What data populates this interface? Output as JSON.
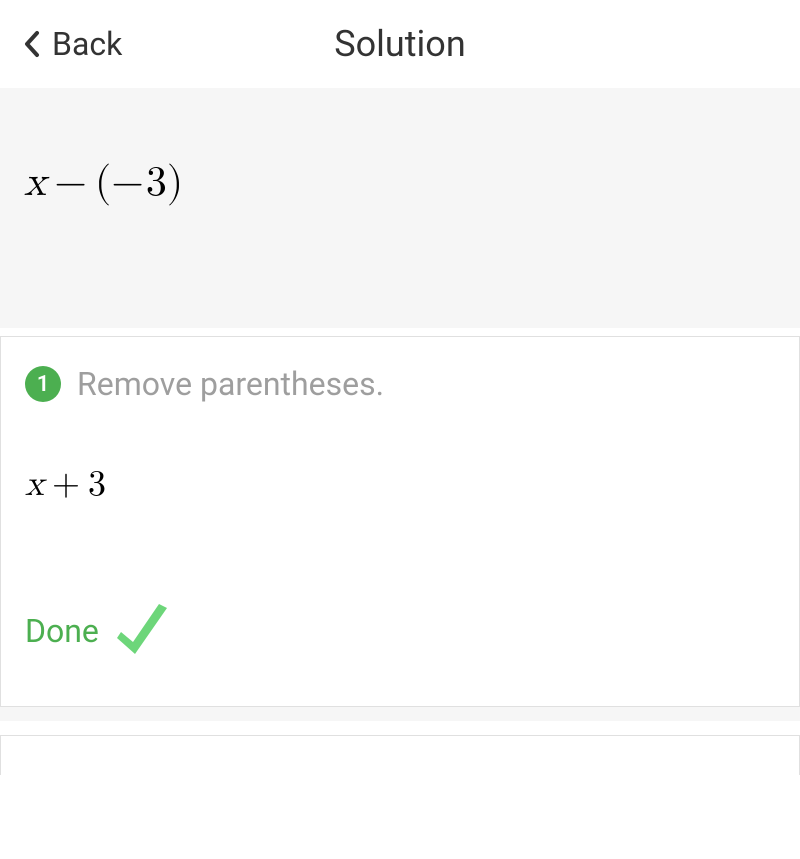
{
  "header": {
    "back_label": "Back",
    "title": "Solution"
  },
  "problem": {
    "expression_var": "x",
    "expression_op1": "−",
    "expression_paren_open": "(",
    "expression_op2": "−",
    "expression_val": "3",
    "expression_paren_close": ")"
  },
  "step": {
    "number": "1",
    "description": "Remove parentheses.",
    "result_var": "x",
    "result_op": "+",
    "result_val": "3"
  },
  "done": {
    "label": "Done"
  }
}
